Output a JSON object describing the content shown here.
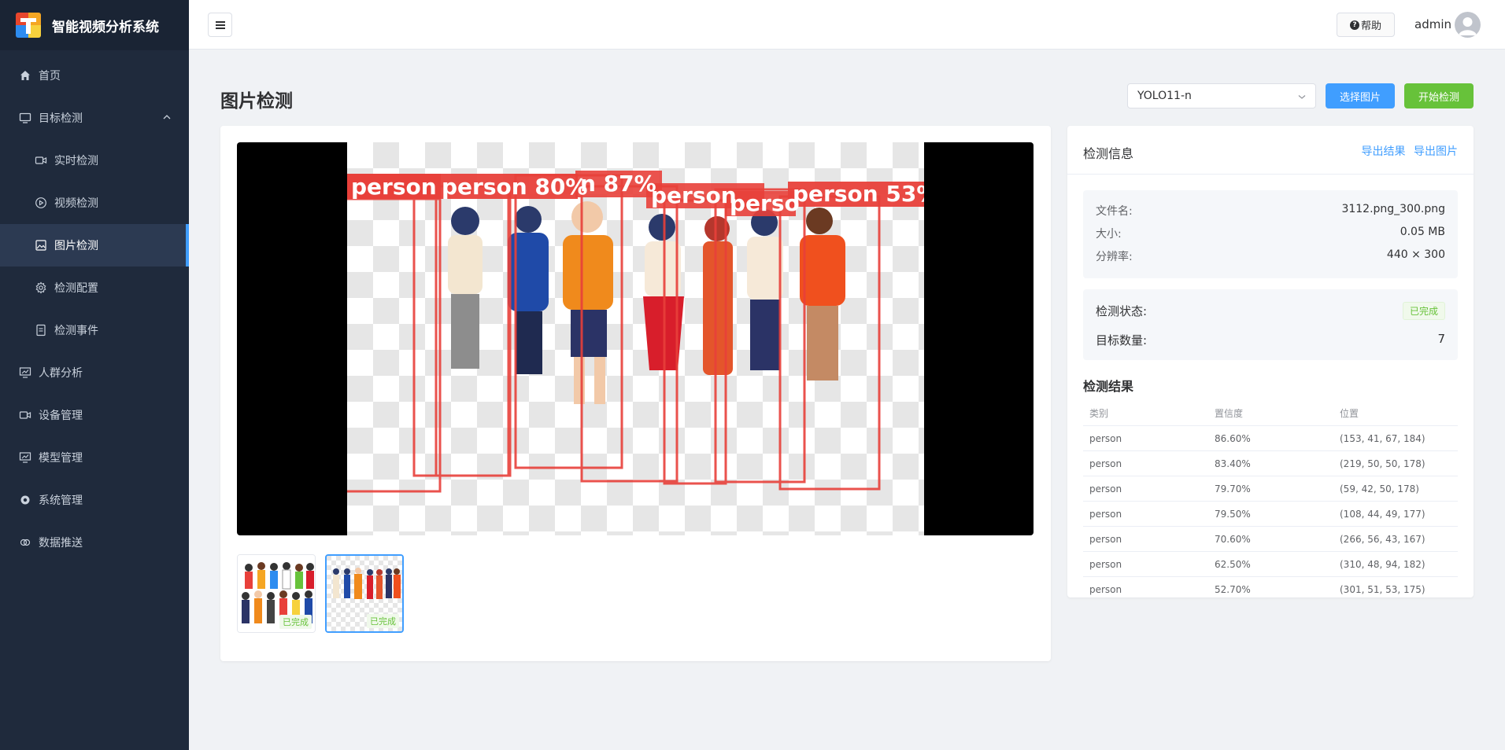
{
  "app": {
    "title": "智能视频分析系统"
  },
  "sidebar": {
    "items": [
      {
        "label": "首页"
      },
      {
        "label": "目标检测"
      },
      {
        "label": "实时检测"
      },
      {
        "label": "视频检测"
      },
      {
        "label": "图片检测"
      },
      {
        "label": "检测配置"
      },
      {
        "label": "检测事件"
      },
      {
        "label": "人群分析"
      },
      {
        "label": "设备管理"
      },
      {
        "label": "模型管理"
      },
      {
        "label": "系统管理"
      },
      {
        "label": "数据推送"
      }
    ]
  },
  "header": {
    "help_label": "帮助",
    "user": "admin"
  },
  "page": {
    "title": "图片检测",
    "model_select": "YOLO11-n",
    "select_image_label": "选择图片",
    "start_detect_label": "开始检测"
  },
  "viewer": {
    "box_labels": [
      "person",
      "person 80%",
      "n 87%",
      "person",
      "perso",
      "person 53%"
    ]
  },
  "thumbnails": [
    {
      "status": "已完成"
    },
    {
      "status": "已完成"
    }
  ],
  "info": {
    "title": "检测信息",
    "export_result": "导出结果",
    "export_image": "导出图片",
    "file_name_label": "文件名:",
    "file_name": "3112.png_300.png",
    "size_label": "大小:",
    "size": "0.05 MB",
    "resolution_label": "分辨率:",
    "resolution": "440 × 300",
    "status_label": "检测状态:",
    "status": "已完成",
    "count_label": "目标数量:",
    "count": "7"
  },
  "results": {
    "title": "检测结果",
    "headers": [
      "类别",
      "置信度",
      "位置"
    ],
    "rows": [
      [
        "person",
        "86.60%",
        "(153, 41, 67, 184)"
      ],
      [
        "person",
        "83.40%",
        "(219, 50, 50, 178)"
      ],
      [
        "person",
        "79.70%",
        "(59, 42, 50, 178)"
      ],
      [
        "person",
        "79.50%",
        "(108, 44, 49, 177)"
      ],
      [
        "person",
        "70.60%",
        "(266, 56, 43, 167)"
      ],
      [
        "person",
        "62.50%",
        "(310, 48, 94, 182)"
      ],
      [
        "person",
        "52.70%",
        "(301, 51, 53, 175)"
      ]
    ]
  },
  "colors": {
    "sidebar_bg": "#1f2a3c",
    "accent": "#409eff",
    "success": "#67c23a",
    "bbox": "#e8403a"
  }
}
